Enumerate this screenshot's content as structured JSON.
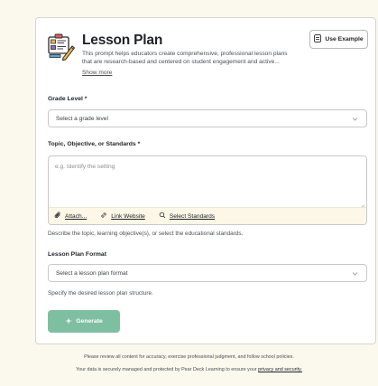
{
  "header": {
    "title": "Lesson Plan",
    "description_line1": "This prompt helps educators create comprehensive, professional lesson plans",
    "description_line2": "that are research-based and centered on student engagement and active...",
    "show_more": "Show more",
    "use_example": "Use Example",
    "icon": "lesson-plan-icon"
  },
  "grade": {
    "label": "Grade Level *",
    "value": "Select a grade level"
  },
  "topic": {
    "label": "Topic, Objective, or Standards *",
    "placeholder": "e.g. Identify the setting",
    "attach": "Attach...",
    "link_website": "Link Website",
    "select_standards": "Select Standards",
    "helper": "Describe the topic, learning objective(s), or select the educational standards."
  },
  "format": {
    "label": "Lesson Plan Format",
    "value": "Select a lesson plan format",
    "helper": "Specify the desired lesson plan structure."
  },
  "generate": {
    "label": "Generate"
  },
  "footer": {
    "line1": "Please review all content for accuracy, exercise professional judgment, and follow school policies.",
    "line2_prefix": "Your data is securely managed and protected by Pear Deck Learning to ensure your",
    "line2_link": "privacy and security."
  },
  "colors": {
    "background": "#fbf8ee",
    "generate_button": "#7fbfa1",
    "toolbar": "#fcf7e6"
  }
}
